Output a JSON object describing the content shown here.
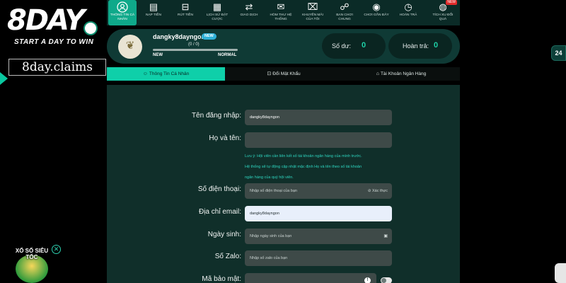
{
  "brand": {
    "logo": "8DAY",
    "tagline": "START A DAY TO WIN",
    "watermark": "8day.claims",
    "promo_label": "XỔ SỐ SIÊU TỐC"
  },
  "topnav": {
    "items": [
      {
        "label": "Thông tin cá nhân",
        "icon": "user-icon",
        "active": true
      },
      {
        "label": "Nạp tiền",
        "icon": "wallet-icon"
      },
      {
        "label": "Rút tiền",
        "icon": "withdraw-icon"
      },
      {
        "label": "Lịch sử đặt cược",
        "icon": "history-icon"
      },
      {
        "label": "Giao dịch",
        "icon": "transfer-icon"
      },
      {
        "label": "Hòm thư hệ thống",
        "icon": "mail-icon"
      },
      {
        "label": "Khuyến mãi của tôi",
        "icon": "gift-icon"
      },
      {
        "label": "Bạn chơi chung",
        "icon": "friends-icon"
      },
      {
        "label": "Chơi gần đây",
        "icon": "gamepad-icon"
      },
      {
        "label": "Hoàn trả",
        "icon": "timer-icon"
      },
      {
        "label": "Tích xu đổi quà",
        "icon": "coin-icon",
        "badge": "NEW"
      }
    ]
  },
  "profile": {
    "username": "dangky8dayngon",
    "badge": "NEW",
    "progress_text": "(0 / 0)",
    "progress_fraction": 0,
    "level_from": "NEW",
    "level_to": "NORMAL",
    "balance_label": "Số dư:",
    "balance_value": "0",
    "rebate_label": "Hoàn trả:",
    "rebate_value": "0"
  },
  "tabs": [
    {
      "label": "Thông Tin Cá Nhân",
      "icon": "user-icon",
      "active": true
    },
    {
      "label": "Đổi Mật Khẩu",
      "icon": "lock-icon"
    },
    {
      "label": "Tài Khoản Ngân Hàng",
      "icon": "bank-icon"
    }
  ],
  "form": {
    "username_label": "Tên đăng nhập:",
    "username_value": "dangky8dayngon",
    "fullname_label": "Họ và tên:",
    "fullname_value": "",
    "note_line1": "Lưu ý: Hội viên cần liên kết số tài khoản ngân hàng của mình trước.",
    "note_line2": "Hệ thống sẽ tự động cập nhật mặc định Họ và tên theo số tài khoản",
    "note_line3": "ngân hàng của quý hội viên.",
    "phone_label": "Số điện thoại:",
    "phone_placeholder": "Nhập số điện thoại của bạn",
    "phone_verify": "Xác thực",
    "email_label": "Địa chỉ email:",
    "email_value": "dangky8dayngon",
    "birthday_label": "Ngày sinh:",
    "birthday_placeholder": "Nhập ngày sinh của bạn",
    "zalo_label": "Số Zalo:",
    "zalo_placeholder": "Nhập số zalo của bạn",
    "security_label": "Mã bảo mật:"
  },
  "colors": {
    "accent": "#0fcfa9",
    "panel": "#102f2a",
    "header": "#0f3a35"
  }
}
